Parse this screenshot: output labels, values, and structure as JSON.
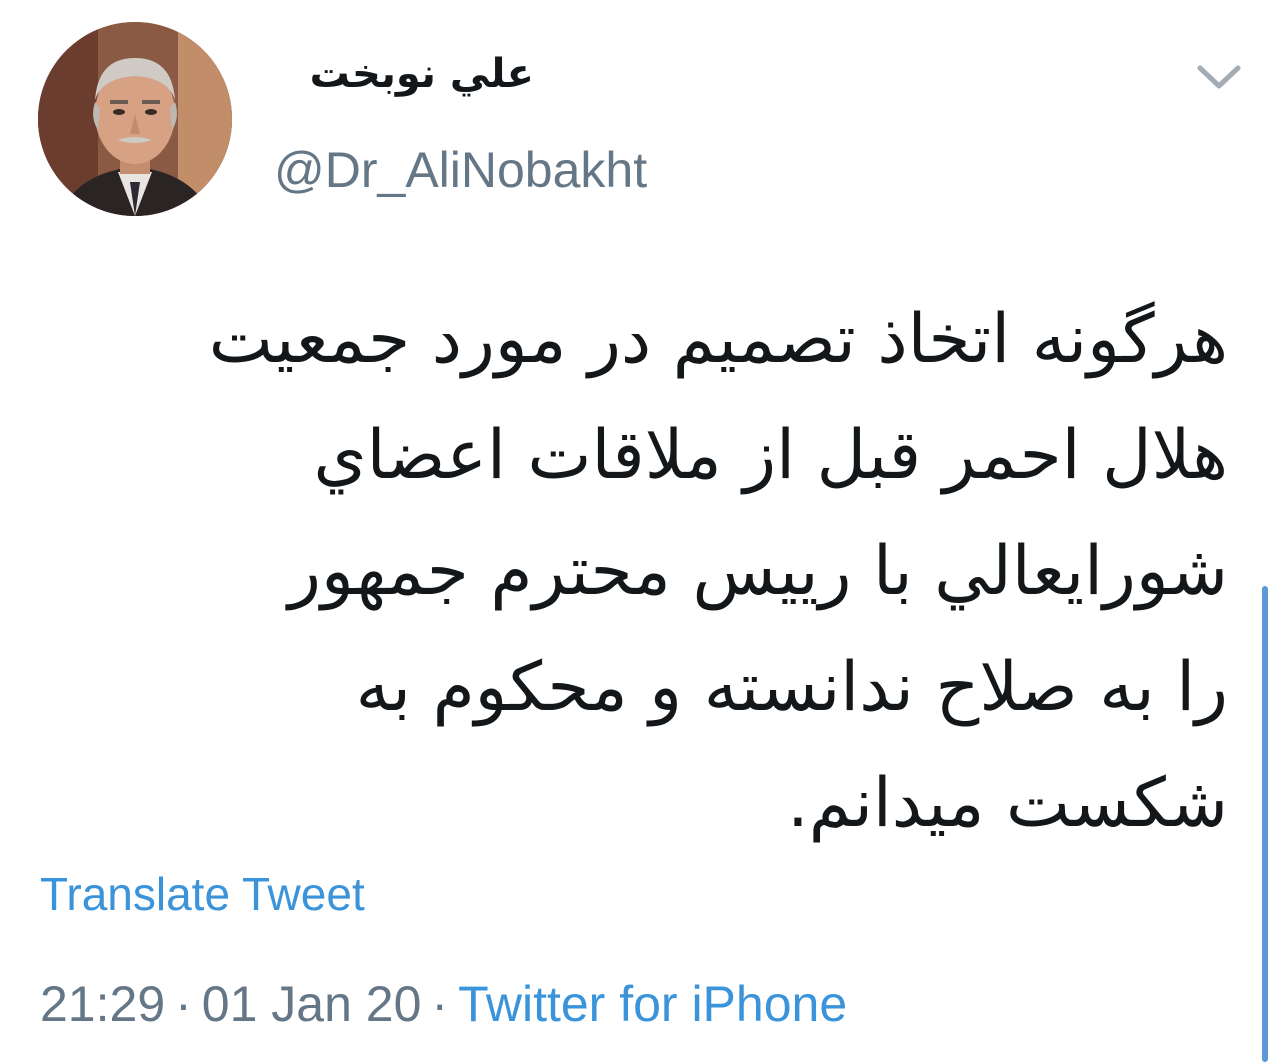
{
  "tweet": {
    "author": {
      "display_name": "علي نوبخت",
      "handle": "@Dr_AliNobakht"
    },
    "text_lines": [
      "هرگونه اتخاذ تصميم در مورد جمعيت",
      "هلال احمر قبل از ملاقات اعضاي",
      "شورايعالي با رييس محترم جمهور",
      "را به صلاح ندانسته و محكوم به",
      "شكست ميدانم."
    ],
    "translate_label": "Translate Tweet",
    "time": "21:29",
    "date": "01 Jan 20",
    "separator": "·",
    "source": "Twitter for iPhone"
  },
  "colors": {
    "link": "#3b94d9",
    "secondary_text": "#657786",
    "primary_text": "#14171a",
    "background": "#ffffff"
  },
  "icons": {
    "caret": "chevron-down-icon",
    "avatar": "profile-photo"
  }
}
